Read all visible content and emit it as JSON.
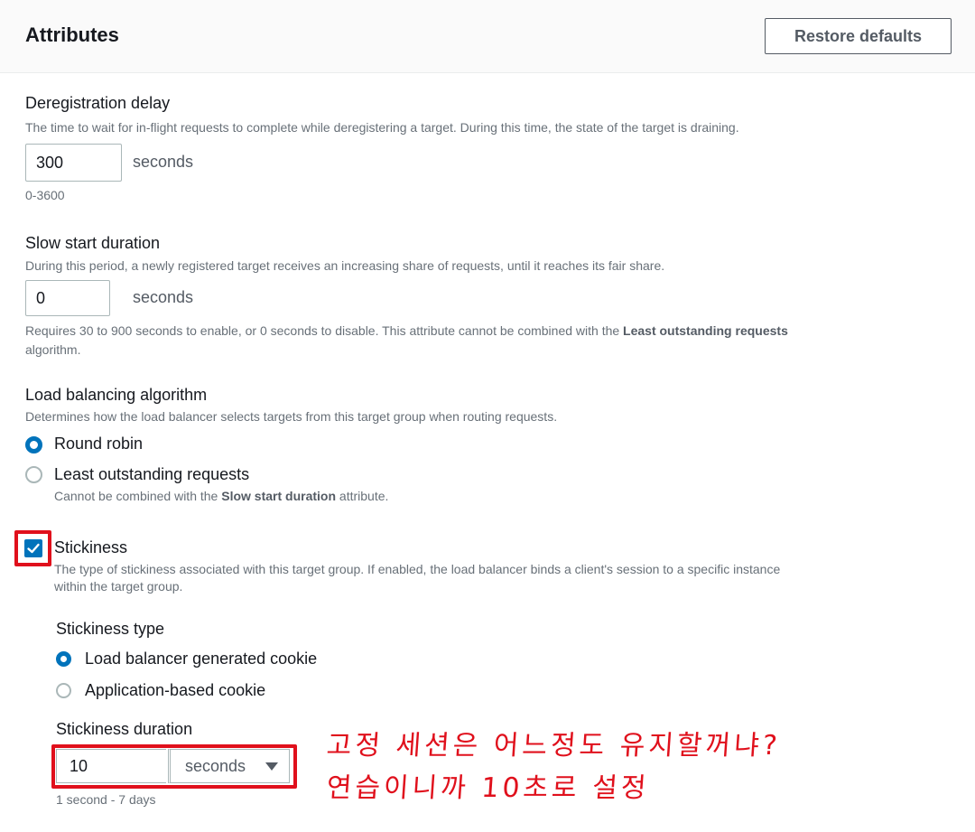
{
  "header": {
    "title": "Attributes",
    "restore_label": "Restore defaults"
  },
  "deregistration": {
    "label": "Deregistration delay",
    "description": "The time to wait for in-flight requests to complete while deregistering a target. During this time, the state of the target is draining.",
    "value": "300",
    "unit": "seconds",
    "range": "0-3600"
  },
  "slow_start": {
    "label": "Slow start duration",
    "description": "During this period, a newly registered target receives an increasing share of requests, until it reaches its fair share.",
    "value": "0",
    "unit": "seconds",
    "hint_prefix": "Requires 30 to 900 seconds to enable, or 0 seconds to disable. This attribute cannot be combined with the ",
    "hint_bold": "Least outstanding requests",
    "hint_line2": "algorithm."
  },
  "algorithm": {
    "label": "Load balancing algorithm",
    "description": "Determines how the load balancer selects targets from this target group when routing requests.",
    "options": [
      {
        "label": "Round robin",
        "selected": true
      },
      {
        "label": "Least outstanding requests",
        "selected": false
      }
    ],
    "least_hint_prefix": "Cannot be combined with the ",
    "least_hint_bold": "Slow start duration",
    "least_hint_suffix": " attribute."
  },
  "stickiness": {
    "label": "Stickiness",
    "checked": true,
    "description_line1": "The type of stickiness associated with this target group. If enabled, the load balancer binds a client's session to a specific instance",
    "description_line2": "within the target group.",
    "type_label": "Stickiness type",
    "type_options": [
      {
        "label": "Load balancer generated cookie",
        "selected": true
      },
      {
        "label": "Application-based cookie",
        "selected": false
      }
    ],
    "duration_label": "Stickiness duration",
    "duration_value": "10",
    "duration_unit": "seconds",
    "duration_range": "1 second - 7 days"
  },
  "annotation": {
    "line1": "고정 세션은 어느정도 유지할꺼냐?",
    "line2": "연습이니까 10초로 설정",
    "color": "#e0101c"
  },
  "colors": {
    "accent": "#0073bb",
    "highlight": "#e0101c"
  },
  "icons": {
    "checkbox": "check-icon",
    "select": "caret-down-icon"
  }
}
